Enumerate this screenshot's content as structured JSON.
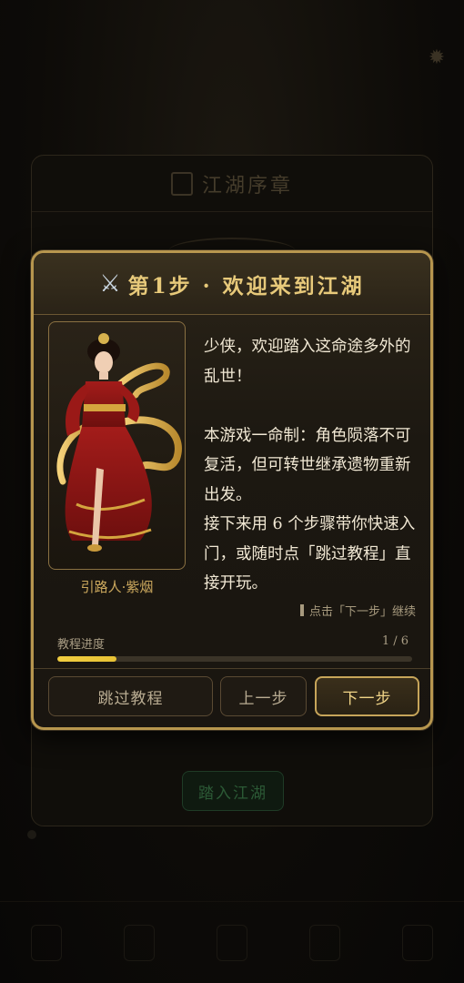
{
  "modal": {
    "title": "第1步 · 欢迎来到江湖",
    "guide_name": "引路人·紫烟",
    "dialog": {
      "line1": "少侠，欢迎踏入这命途多外的乱世！",
      "line2": "本游戏一命制：角色陨落不可复活，但可转世继承遗物重新出发。",
      "line3": "接下来用 6 个步骤带你快速入门，或随时点「跳过教程」直接开玩。"
    },
    "hint": "点击「下一步」继续",
    "progress": {
      "label": "教程进度",
      "count": "1 / 6",
      "fraction": 0.1667
    },
    "buttons": {
      "skip": "跳过教程",
      "prev": "上一步",
      "next": "下一步"
    }
  },
  "background": {
    "card_title": "江湖序章",
    "enter_button": "踏入江湖"
  },
  "colors": {
    "accent_gold": "#b7964e",
    "title_gold": "#e7c97a",
    "progress_yellow": "#f0cd40"
  }
}
